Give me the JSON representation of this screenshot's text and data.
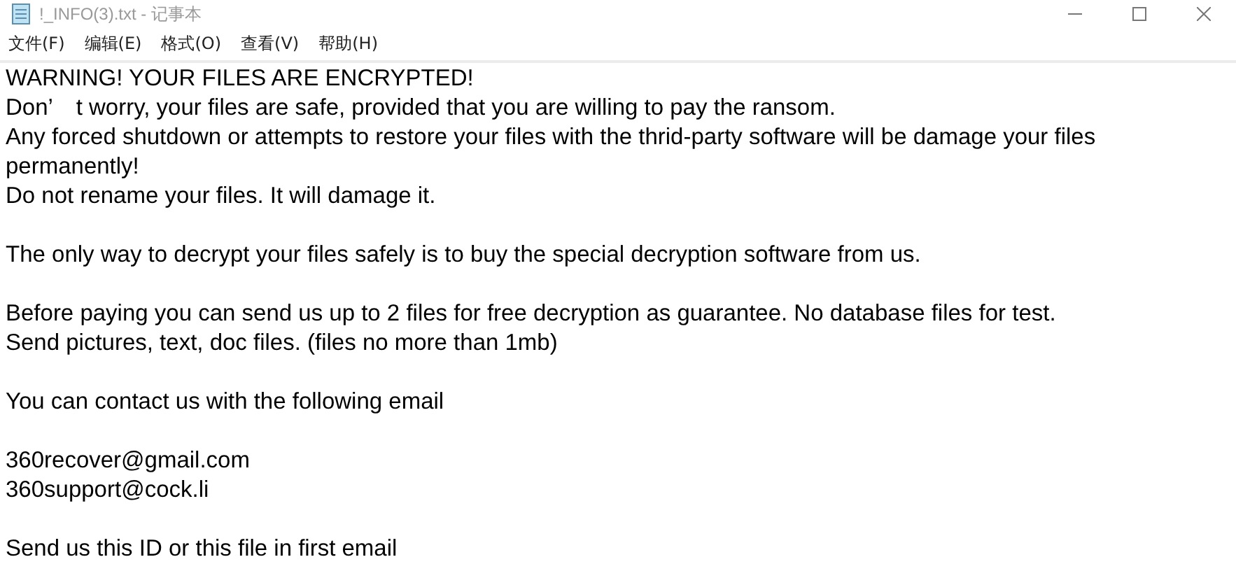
{
  "window": {
    "title": "!_INFO(3).txt - 记事本"
  },
  "menu": [
    "文件(F)",
    "编辑(E)",
    "格式(O)",
    "查看(V)",
    "帮助(H)"
  ],
  "document": {
    "paragraphs": [
      [
        "WARNING! YOUR FILES ARE ENCRYPTED!",
        "Don’　t worry, your files are safe, provided that you are willing to pay the ransom.",
        "Any forced shutdown or attempts to restore your files with the thrid-party software will be damage your files permanently!",
        "Do not rename your files. It will damage it."
      ],
      [
        "The only way to decrypt your files safely is to buy the special decryption software from us."
      ],
      [
        "Before paying you can send us up to 2 files for free decryption as guarantee. No database files for test.",
        "Send pictures, text, doc files. (files no more than 1mb)"
      ],
      [
        "You can contact us with the following email"
      ],
      [
        "360recover@gmail.com",
        "360support@cock.li"
      ],
      [
        "Send us this ID or this file in first email"
      ]
    ]
  }
}
